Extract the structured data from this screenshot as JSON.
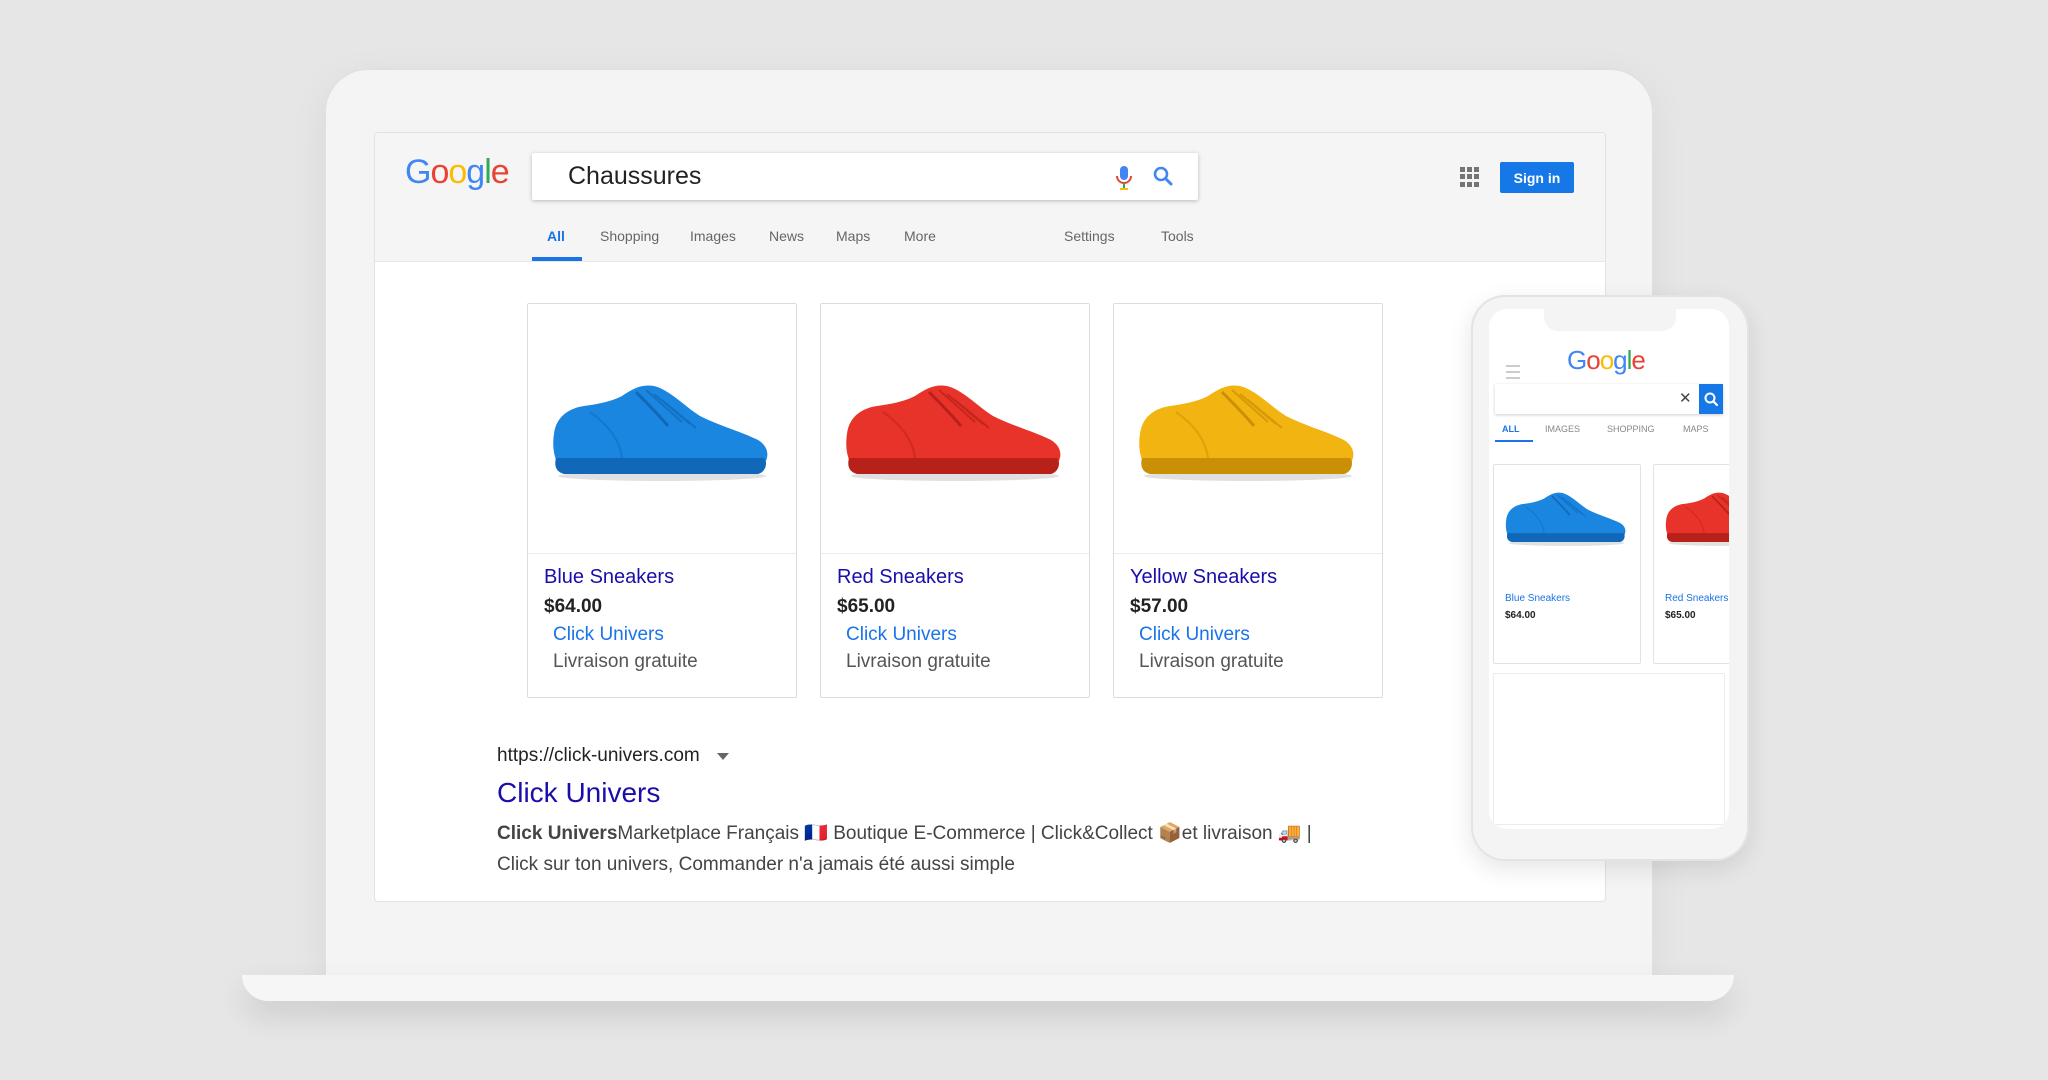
{
  "logo": {
    "letters": [
      {
        "ch": "G",
        "color": "#4285F4"
      },
      {
        "ch": "o",
        "color": "#EA4335"
      },
      {
        "ch": "o",
        "color": "#FBBC05"
      },
      {
        "ch": "g",
        "color": "#4285F4"
      },
      {
        "ch": "l",
        "color": "#34A853"
      },
      {
        "ch": "e",
        "color": "#EA4335"
      }
    ]
  },
  "search": {
    "query": "Chaussures"
  },
  "header": {
    "signin_label": "Sign in"
  },
  "tabs": [
    {
      "label": "All",
      "active": true
    },
    {
      "label": "Shopping",
      "active": false
    },
    {
      "label": "Images",
      "active": false
    },
    {
      "label": "News",
      "active": false
    },
    {
      "label": "Maps",
      "active": false
    },
    {
      "label": "More",
      "active": false
    }
  ],
  "tools": {
    "settings": "Settings",
    "tools": "Tools"
  },
  "products": [
    {
      "title": "Blue Sneakers",
      "price": "$64.00",
      "store": "Click Univers",
      "shipping": "Livraison gratuite",
      "color": "#1a86e0",
      "dark": "#1168b8"
    },
    {
      "title": "Red Sneakers",
      "price": "$65.00",
      "store": "Click Univers",
      "shipping": "Livraison gratuite",
      "color": "#e8332a",
      "dark": "#b8201a"
    },
    {
      "title": "Yellow Sneakers",
      "price": "$57.00",
      "store": "Click Univers",
      "shipping": "Livraison gratuite",
      "color": "#f2b410",
      "dark": "#c98f05"
    }
  ],
  "result": {
    "url": "https://click-univers.com",
    "title": "Click Univers",
    "desc_bold": "Click Univers",
    "desc_line1": "Marketplace Français 🇫🇷 Boutique E-Commerce | Click&Collect 📦et livraison 🚚 |",
    "desc_line2": "Click sur ton univers, Commander n'a jamais été aussi simple"
  },
  "phone": {
    "close_glyph": "✕",
    "tabs": [
      "ALL",
      "IMAGES",
      "SHOPPING",
      "MAPS"
    ],
    "products": [
      {
        "title": "Blue Sneakers",
        "price": "$64.00"
      },
      {
        "title": "Red Sneakers",
        "price": "$65.00"
      }
    ]
  }
}
